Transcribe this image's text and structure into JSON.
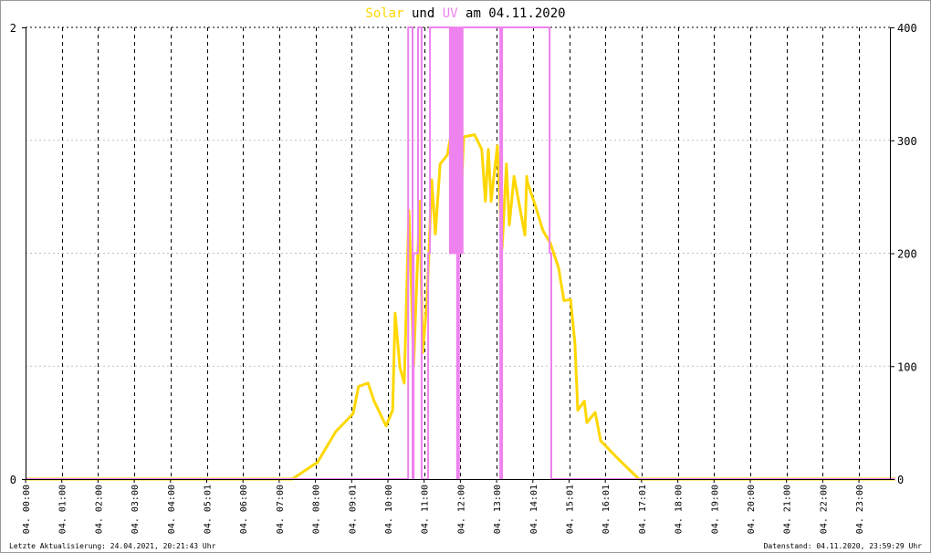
{
  "chart_data": {
    "type": "line",
    "title": {
      "part1": "Solar",
      "part2": "und",
      "part3": "UV",
      "part4": "am 04.11.2020"
    },
    "colors": {
      "solar": "#FFD700",
      "uv": "#EE82EE",
      "axis": "#000000",
      "grid": "#c0c0c0"
    },
    "x_range_hours": [
      0,
      24
    ],
    "x_tick_labels": [
      "04. 00:00",
      "04. 01:00",
      "04. 02:00",
      "04. 03:00",
      "04. 04:00",
      "04. 05:01",
      "04. 06:00",
      "04. 07:00",
      "04. 08:00",
      "04. 09:01",
      "04. 10:00",
      "04. 11:00",
      "04. 12:00",
      "04. 13:00",
      "04. 14:01",
      "04. 15:01",
      "04. 16:01",
      "04. 17:01",
      "04. 18:00",
      "04. 19:00",
      "04. 20:00",
      "04. 21:00",
      "04. 22:00",
      "04. 23:00"
    ],
    "y_left": {
      "range": [
        0,
        2
      ],
      "ticks": [
        "0",
        "2"
      ]
    },
    "y_right": {
      "range": [
        0,
        400
      ],
      "ticks": [
        "0",
        "100",
        "200",
        "300",
        "400"
      ]
    },
    "series": [
      {
        "name": "Solar",
        "axis": "right",
        "points": [
          [
            0,
            0
          ],
          [
            7.36,
            0
          ],
          [
            8.06,
            15
          ],
          [
            8.56,
            42
          ],
          [
            9.04,
            58
          ],
          [
            9.19,
            82
          ],
          [
            9.45,
            85
          ],
          [
            9.62,
            69
          ],
          [
            9.95,
            47
          ],
          [
            10.13,
            61
          ],
          [
            10.2,
            147
          ],
          [
            10.33,
            99
          ],
          [
            10.45,
            85
          ],
          [
            10.58,
            238
          ],
          [
            10.71,
            101
          ],
          [
            10.88,
            246
          ],
          [
            10.96,
            112
          ],
          [
            11.08,
            158
          ],
          [
            11.21,
            265
          ],
          [
            11.31,
            217
          ],
          [
            11.44,
            279
          ],
          [
            11.64,
            287
          ],
          [
            11.76,
            309
          ],
          [
            11.81,
            212
          ],
          [
            11.89,
            310
          ],
          [
            11.96,
            206
          ],
          [
            12.09,
            303
          ],
          [
            12.39,
            305
          ],
          [
            12.59,
            292
          ],
          [
            12.69,
            246
          ],
          [
            12.77,
            292
          ],
          [
            12.85,
            246
          ],
          [
            13.02,
            295
          ],
          [
            13.15,
            204
          ],
          [
            13.27,
            279
          ],
          [
            13.35,
            225
          ],
          [
            13.48,
            268
          ],
          [
            13.78,
            216
          ],
          [
            13.83,
            268
          ],
          [
            13.85,
            263
          ],
          [
            14.08,
            241
          ],
          [
            14.28,
            220
          ],
          [
            14.48,
            209
          ],
          [
            14.71,
            187
          ],
          [
            14.86,
            158
          ],
          [
            15.04,
            159
          ],
          [
            15.16,
            120
          ],
          [
            15.24,
            61
          ],
          [
            15.42,
            69
          ],
          [
            15.49,
            50
          ],
          [
            15.72,
            59
          ],
          [
            15.87,
            34
          ],
          [
            16.35,
            18
          ],
          [
            16.93,
            0
          ],
          [
            24,
            0
          ]
        ]
      },
      {
        "name": "UV",
        "axis": "left",
        "step": true,
        "points": [
          [
            0,
            0
          ],
          [
            10.56,
            2
          ],
          [
            10.68,
            0
          ],
          [
            10.71,
            1
          ],
          [
            10.83,
            2
          ],
          [
            10.93,
            0
          ],
          [
            11.11,
            1
          ],
          [
            11.16,
            2
          ],
          [
            11.71,
            1
          ],
          [
            11.76,
            2
          ],
          [
            11.81,
            1
          ],
          [
            11.86,
            2
          ],
          [
            11.91,
            0
          ],
          [
            11.96,
            2
          ],
          [
            12.01,
            1
          ],
          [
            12.06,
            2
          ],
          [
            13.1,
            0
          ],
          [
            13.15,
            2
          ],
          [
            14.46,
            1
          ],
          [
            14.51,
            0
          ],
          [
            24,
            0
          ]
        ]
      }
    ]
  },
  "footer": {
    "left": "Letzte Aktualisierung: 24.04.2021, 20:21:43 Uhr",
    "right": "Datenstand: 04.11.2020, 23:59:29 Uhr"
  }
}
